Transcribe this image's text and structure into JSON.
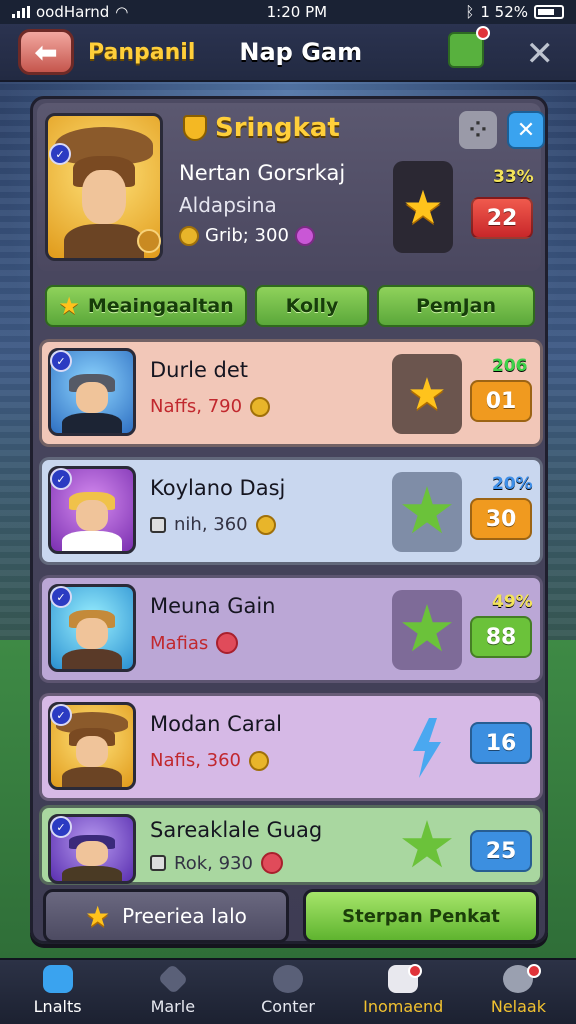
{
  "status_bar": {
    "carrier": "oodHarnd",
    "time": "1:20 PM",
    "battery": "1 52%"
  },
  "top_bar": {
    "title_left": "Panpanil",
    "title_center": "Nap Gam"
  },
  "header": {
    "rank_title": "Sringkat",
    "player_name": "Nertan Gorsrkaj",
    "player_sub": "Aldapsina",
    "coins_text": "Grib; 300",
    "percent": "33%",
    "score": "22"
  },
  "tabs": [
    {
      "label": "Meaingaaltan",
      "has_star": true
    },
    {
      "label": "Kolly",
      "has_star": false
    },
    {
      "label": "PemJan",
      "has_star": false
    }
  ],
  "rows": [
    {
      "title": "Durle det",
      "sub": "Naffs, 790",
      "sub_icon": "coin-icon",
      "percent": "206",
      "score": "01",
      "reward_icon": "gold-star-icon",
      "bg": "#f2c7b8",
      "box_bg": "#6b554e",
      "score_color": "#f09a1f",
      "pct_color": "#3ed24a",
      "sub_color": "#c1282e"
    },
    {
      "title": "Koylano Dasj",
      "sub": "nih, 360",
      "sub_icon": "coin-icon",
      "percent": "20%",
      "score": "30",
      "reward_icon": "green-star-icon",
      "bg": "#c9d7ef",
      "box_bg": "#7f8da7",
      "score_color": "#f09a1f",
      "pct_color": "#3f8fe8",
      "sub_color": "#333344"
    },
    {
      "title": "Meuna Gain",
      "sub": "Mafias",
      "sub_icon": "gem-red-icon",
      "percent": "49%",
      "score": "88",
      "reward_icon": "green-star-icon",
      "bg": "#bba7d6",
      "box_bg": "#7e6b98",
      "score_color": "#6bc23a",
      "pct_color": "#f3e35a",
      "sub_color": "#c1282e"
    },
    {
      "title": "Modan Caral",
      "sub": "Nafis, 360",
      "sub_icon": "coin-icon",
      "percent": "",
      "score": "16",
      "reward_icon": "bolt-icon",
      "bg": "#d6b9e6",
      "box_bg": "#d6b9e6",
      "score_color": "#3c8fe0",
      "pct_color": "#3ed24a",
      "sub_color": "#c1282e"
    },
    {
      "title": "Sareaklale Guag",
      "sub": "Rok, 930",
      "sub_icon": "gem-red-icon",
      "percent": "",
      "score": "25",
      "reward_icon": "green-star-icon",
      "bg": "#a9d7a0",
      "box_bg": "#a9d7a0",
      "score_color": "#3c8fe0",
      "pct_color": "#3ed24a",
      "sub_color": "#333344"
    }
  ],
  "actions": {
    "left_label": "Preeriea Ialo",
    "right_label": "Sterpan Penkat"
  },
  "bottom_nav": [
    {
      "label": "Lnalts",
      "icon": "home-icon",
      "notify": false
    },
    {
      "label": "Marle",
      "icon": "diamond-icon",
      "notify": false
    },
    {
      "label": "Conter",
      "icon": "controller-icon",
      "notify": false
    },
    {
      "label": "Inomaend",
      "icon": "dice-icon",
      "notify": true
    },
    {
      "label": "Nelaak",
      "icon": "gear-icon",
      "notify": true
    }
  ]
}
